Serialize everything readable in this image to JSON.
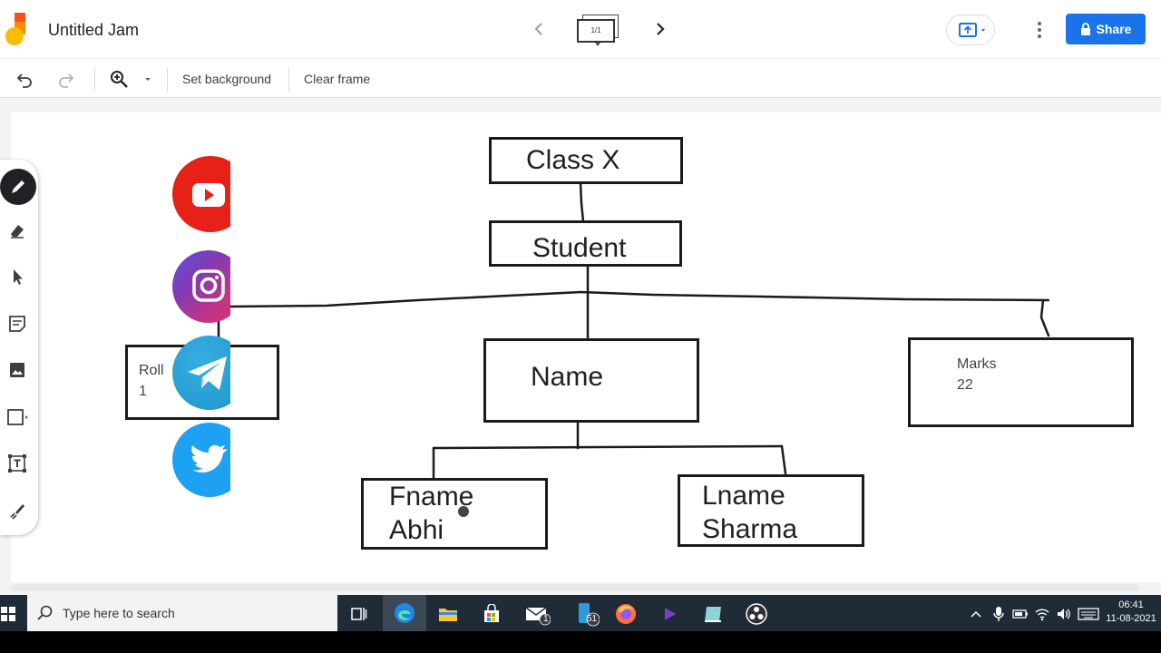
{
  "header": {
    "title": "Untitled Jam",
    "frame_indicator": "1/1",
    "share_label": "Share"
  },
  "toolbar": {
    "set_background": "Set background",
    "clear_frame": "Clear frame"
  },
  "diagram": {
    "class_label": "Class X",
    "student_label": "Student",
    "roll_title": "Roll",
    "roll_value": "1",
    "name_label": "Name",
    "marks_title": "Marks",
    "marks_value": "22",
    "fname_title": "Fname",
    "fname_value": "Abhi",
    "lname_title": "Lname",
    "lname_value": "Sharma"
  },
  "social_icons": [
    "youtube-icon",
    "instagram-icon",
    "telegram-icon",
    "twitter-icon"
  ],
  "taskbar": {
    "search_placeholder": "Type here to search",
    "mail_badge": "1",
    "phone_badge": "51",
    "time": "06:41",
    "date": "11-08-2021"
  },
  "colors": {
    "share_blue": "#1a73e8",
    "youtube_red": "#e62117",
    "telegram_blue": "#2ca5e0",
    "twitter_blue": "#1da1f2",
    "taskbar": "#1f2b36"
  }
}
